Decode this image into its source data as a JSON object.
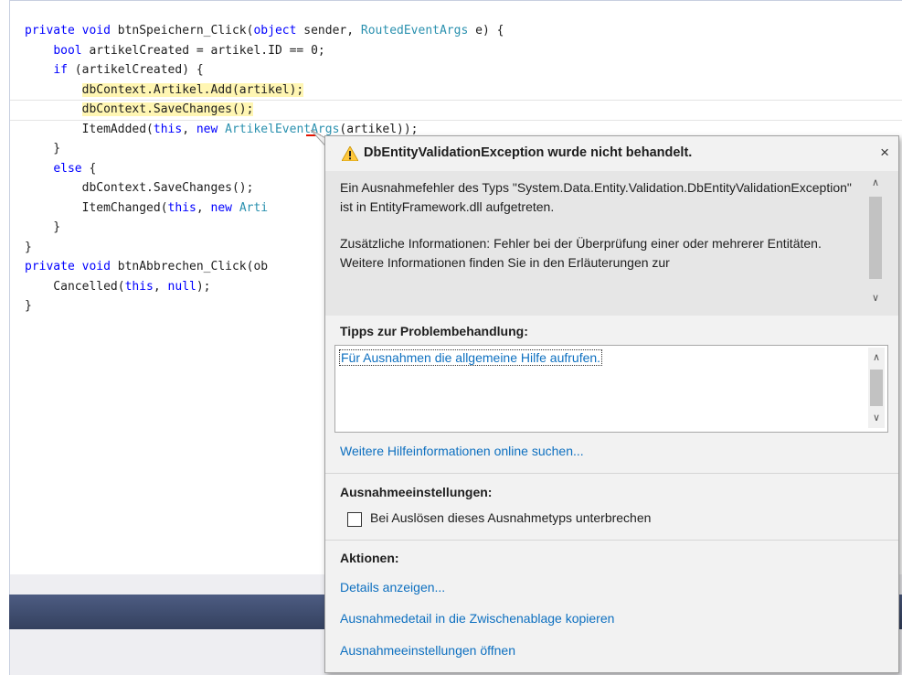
{
  "code": {
    "lines": [
      [
        {
          "t": "private void ",
          "c": "kw"
        },
        {
          "t": "btnSpeichern_Click(",
          "c": ""
        },
        {
          "t": "object",
          "c": "kw"
        },
        {
          "t": " sender, ",
          "c": ""
        },
        {
          "t": "RoutedEventArgs",
          "c": "ty"
        },
        {
          "t": " e) {",
          "c": ""
        }
      ],
      [
        {
          "t": "    ",
          "c": ""
        },
        {
          "t": "bool",
          "c": "kw"
        },
        {
          "t": " artikelCreated = artikel.ID == 0;",
          "c": ""
        }
      ],
      [
        {
          "t": "    ",
          "c": ""
        },
        {
          "t": "if",
          "c": "kw"
        },
        {
          "t": " (artikelCreated) {",
          "c": ""
        }
      ],
      [
        {
          "t": "        ",
          "c": ""
        },
        {
          "t": "dbContext.Artikel.Add(artikel);",
          "c": "hl"
        }
      ],
      [
        {
          "t": "        ",
          "c": ""
        },
        {
          "t": "dbContext.SaveChanges();",
          "c": "hl"
        }
      ],
      [
        {
          "t": "        ItemAdded(",
          "c": ""
        },
        {
          "t": "this",
          "c": "kw"
        },
        {
          "t": ", ",
          "c": ""
        },
        {
          "t": "new",
          "c": "kw"
        },
        {
          "t": " ",
          "c": ""
        },
        {
          "t": "ArtikelEventArgs",
          "c": "ty"
        },
        {
          "t": "(artikel));",
          "c": ""
        }
      ],
      [
        {
          "t": "    }",
          "c": ""
        }
      ],
      [
        {
          "t": "    ",
          "c": ""
        },
        {
          "t": "else",
          "c": "kw"
        },
        {
          "t": " {",
          "c": ""
        }
      ],
      [
        {
          "t": "        dbContext.SaveChanges();",
          "c": ""
        }
      ],
      [
        {
          "t": "        ItemChanged(",
          "c": ""
        },
        {
          "t": "this",
          "c": "kw"
        },
        {
          "t": ", ",
          "c": ""
        },
        {
          "t": "new",
          "c": "kw"
        },
        {
          "t": " ",
          "c": ""
        },
        {
          "t": "Arti",
          "c": "ty"
        }
      ],
      [
        {
          "t": "    }",
          "c": ""
        }
      ],
      [
        {
          "t": "}",
          "c": ""
        }
      ],
      [
        {
          "t": "private void ",
          "c": "kw"
        },
        {
          "t": "btnAbbrechen_Click(ob",
          "c": ""
        }
      ],
      [
        {
          "t": "    Cancelled(",
          "c": ""
        },
        {
          "t": "this",
          "c": "kw"
        },
        {
          "t": ", ",
          "c": ""
        },
        {
          "t": "null",
          "c": "kw"
        },
        {
          "t": ");",
          "c": ""
        }
      ],
      [
        {
          "t": "}",
          "c": ""
        }
      ]
    ]
  },
  "popup": {
    "title": "DbEntityValidationException wurde nicht behandelt.",
    "close": "×",
    "message_p1": "Ein Ausnahmefehler des Typs \"System.Data.Entity.Validation.DbEntityValidationException\" ist in EntityFramework.dll aufgetreten.",
    "message_p2": "Zusätzliche Informationen: Fehler bei der Überprüfung einer oder mehrerer Entitäten. Weitere Informationen finden Sie in den Erläuterungen zur",
    "tips_title": "Tipps zur Problembehandlung:",
    "tips_link": "Für Ausnahmen die allgemeine Hilfe aufrufen.",
    "more_help_link": "Weitere Hilfeinformationen online suchen...",
    "settings_title": "Ausnahmeeinstellungen:",
    "break_checkbox_label": "Bei Auslösen dieses Ausnahmetyps unterbrechen",
    "actions_title": "Aktionen:",
    "actions": [
      "Details anzeigen...",
      "Ausnahmedetail in die Zwischenablage kopieren",
      "Ausnahmeeinstellungen öffnen"
    ]
  },
  "colors": {
    "keyword": "#0000ff",
    "type": "#2b91af",
    "link": "#0e70c0",
    "highlight": "#fff6b3",
    "warning": "#ffc83d"
  }
}
